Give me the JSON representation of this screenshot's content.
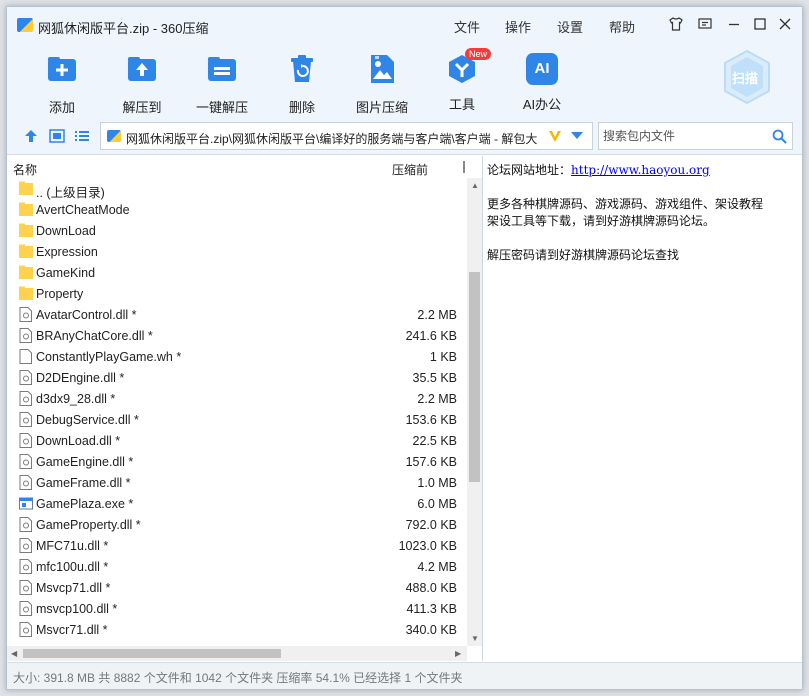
{
  "window": {
    "title": "网狐休闲版平台.zip - 360压缩",
    "menu": [
      "文件",
      "操作",
      "设置",
      "帮助"
    ]
  },
  "toolbar": {
    "buttons": [
      {
        "label": "添加",
        "icon": "add-icon"
      },
      {
        "label": "解压到",
        "icon": "extract-to-icon"
      },
      {
        "label": "一键解压",
        "icon": "one-click-extract-icon"
      },
      {
        "label": "删除",
        "icon": "delete-icon"
      },
      {
        "label": "图片压缩",
        "icon": "image-compress-icon"
      },
      {
        "label": "工具",
        "icon": "tools-icon",
        "badge": "New"
      },
      {
        "label": "AI办公",
        "icon": "ai-office-icon",
        "icon_text": "AI"
      }
    ],
    "scan_label": "扫描"
  },
  "address": {
    "path": "网狐休闲版平台.zip\\网狐休闲版平台\\编译好的服务端与客户端\\客户端 - 解包大",
    "search_placeholder": "搜索包内文件"
  },
  "filelist": {
    "columns": {
      "name": "名称",
      "size": "压缩前"
    },
    "rows": [
      {
        "name": ".. (上级目录)",
        "type": "folder",
        "size": ""
      },
      {
        "name": "AvertCheatMode",
        "type": "folder",
        "size": ""
      },
      {
        "name": "DownLoad",
        "type": "folder",
        "size": ""
      },
      {
        "name": "Expression",
        "type": "folder",
        "size": ""
      },
      {
        "name": "GameKind",
        "type": "folder",
        "size": ""
      },
      {
        "name": "Property",
        "type": "folder",
        "size": ""
      },
      {
        "name": "AvatarControl.dll *",
        "type": "dll",
        "size": "2.2 MB"
      },
      {
        "name": "BRAnyChatCore.dll *",
        "type": "dll",
        "size": "241.6 KB"
      },
      {
        "name": "ConstantlyPlayGame.wh *",
        "type": "file",
        "size": "1 KB"
      },
      {
        "name": "D2DEngine.dll *",
        "type": "dll",
        "size": "35.5 KB"
      },
      {
        "name": "d3dx9_28.dll *",
        "type": "dll",
        "size": "2.2 MB"
      },
      {
        "name": "DebugService.dll *",
        "type": "dll",
        "size": "153.6 KB"
      },
      {
        "name": "DownLoad.dll *",
        "type": "dll",
        "size": "22.5 KB"
      },
      {
        "name": "GameEngine.dll *",
        "type": "dll",
        "size": "157.6 KB"
      },
      {
        "name": "GameFrame.dll *",
        "type": "dll",
        "size": "1.0 MB"
      },
      {
        "name": "GamePlaza.exe *",
        "type": "exe",
        "size": "6.0 MB"
      },
      {
        "name": "GameProperty.dll *",
        "type": "dll",
        "size": "792.0 KB"
      },
      {
        "name": "MFC71u.dll *",
        "type": "dll",
        "size": "1023.0 KB"
      },
      {
        "name": "mfc100u.dll *",
        "type": "dll",
        "size": "4.2 MB"
      },
      {
        "name": "Msvcp71.dll *",
        "type": "dll",
        "size": "488.0 KB"
      },
      {
        "name": "msvcp100.dll *",
        "type": "dll",
        "size": "411.3 KB"
      },
      {
        "name": "Msvcr71.dll *",
        "type": "dll",
        "size": "340.0 KB"
      }
    ]
  },
  "comment": {
    "line1_label": "论坛网站地址：",
    "line1_link": "http://www.haoyou.org",
    "line2": "更多各种棋牌源码、游戏源码、游戏组件、架设教程",
    "line3": "架设工具等下载，请到好游棋牌源码论坛。",
    "line4": "解压密码请到好游棋牌源码论坛查找"
  },
  "status": {
    "text": "大小: 391.8 MB 共 8882 个文件和 1042 个文件夹 压缩率 54.1% 已经选择 1 个文件夹"
  },
  "colors": {
    "accent": "#2f86e6",
    "folder": "#ffd24d",
    "chrome_bg": "#eef5fc"
  }
}
